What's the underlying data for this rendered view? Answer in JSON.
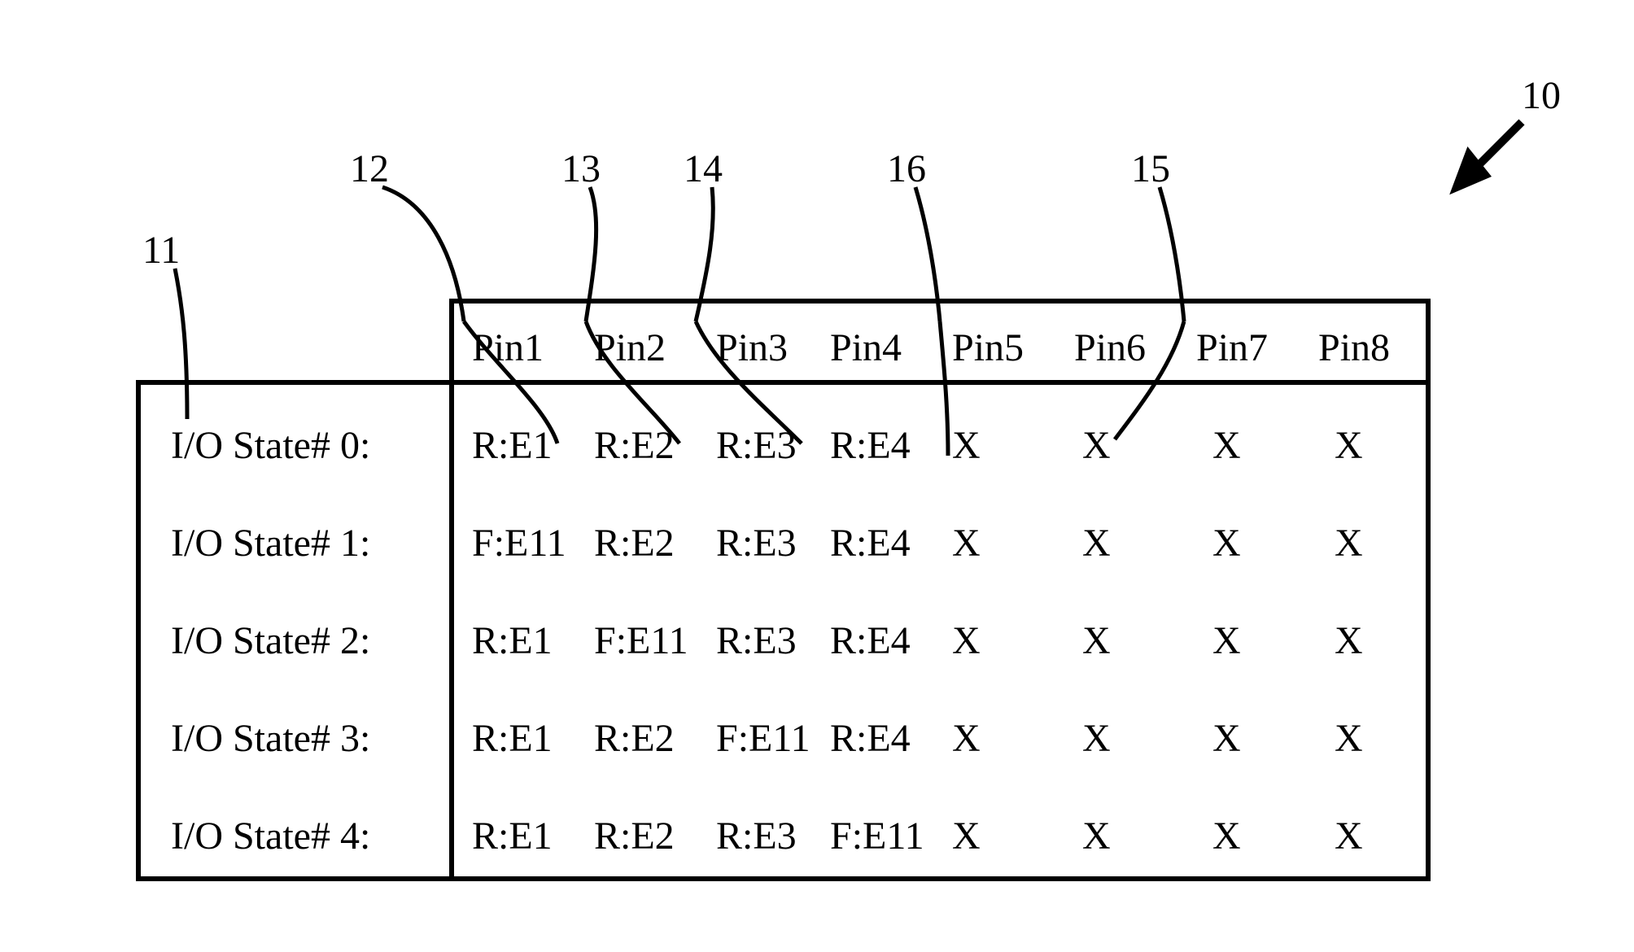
{
  "labels": {
    "l10": "10",
    "l11": "11",
    "l12": "12",
    "l13": "13",
    "l14": "14",
    "l15": "15",
    "l16": "16"
  },
  "headers": [
    "Pin1",
    "Pin2",
    "Pin3",
    "Pin4",
    "Pin5",
    "Pin6",
    "Pin7",
    "Pin8"
  ],
  "rows": [
    {
      "label": "I/O State# 0:",
      "cells": [
        "R:E1",
        "R:E2",
        "R:E3",
        "R:E4",
        "X",
        "X",
        "X",
        "X"
      ]
    },
    {
      "label": "I/O State# 1:",
      "cells": [
        "F:E11",
        "R:E2",
        "R:E3",
        "R:E4",
        "X",
        "X",
        "X",
        "X"
      ]
    },
    {
      "label": "I/O State# 2:",
      "cells": [
        "R:E1",
        "F:E11",
        "R:E3",
        "R:E4",
        "X",
        "X",
        "X",
        "X"
      ]
    },
    {
      "label": "I/O State# 3:",
      "cells": [
        "R:E1",
        "R:E2",
        "F:E11",
        "R:E4",
        "X",
        "X",
        "X",
        "X"
      ]
    },
    {
      "label": "I/O State# 4:",
      "cells": [
        "R:E1",
        "R:E2",
        "R:E3",
        "F:E11",
        "X",
        "X",
        "X",
        "X"
      ]
    }
  ]
}
